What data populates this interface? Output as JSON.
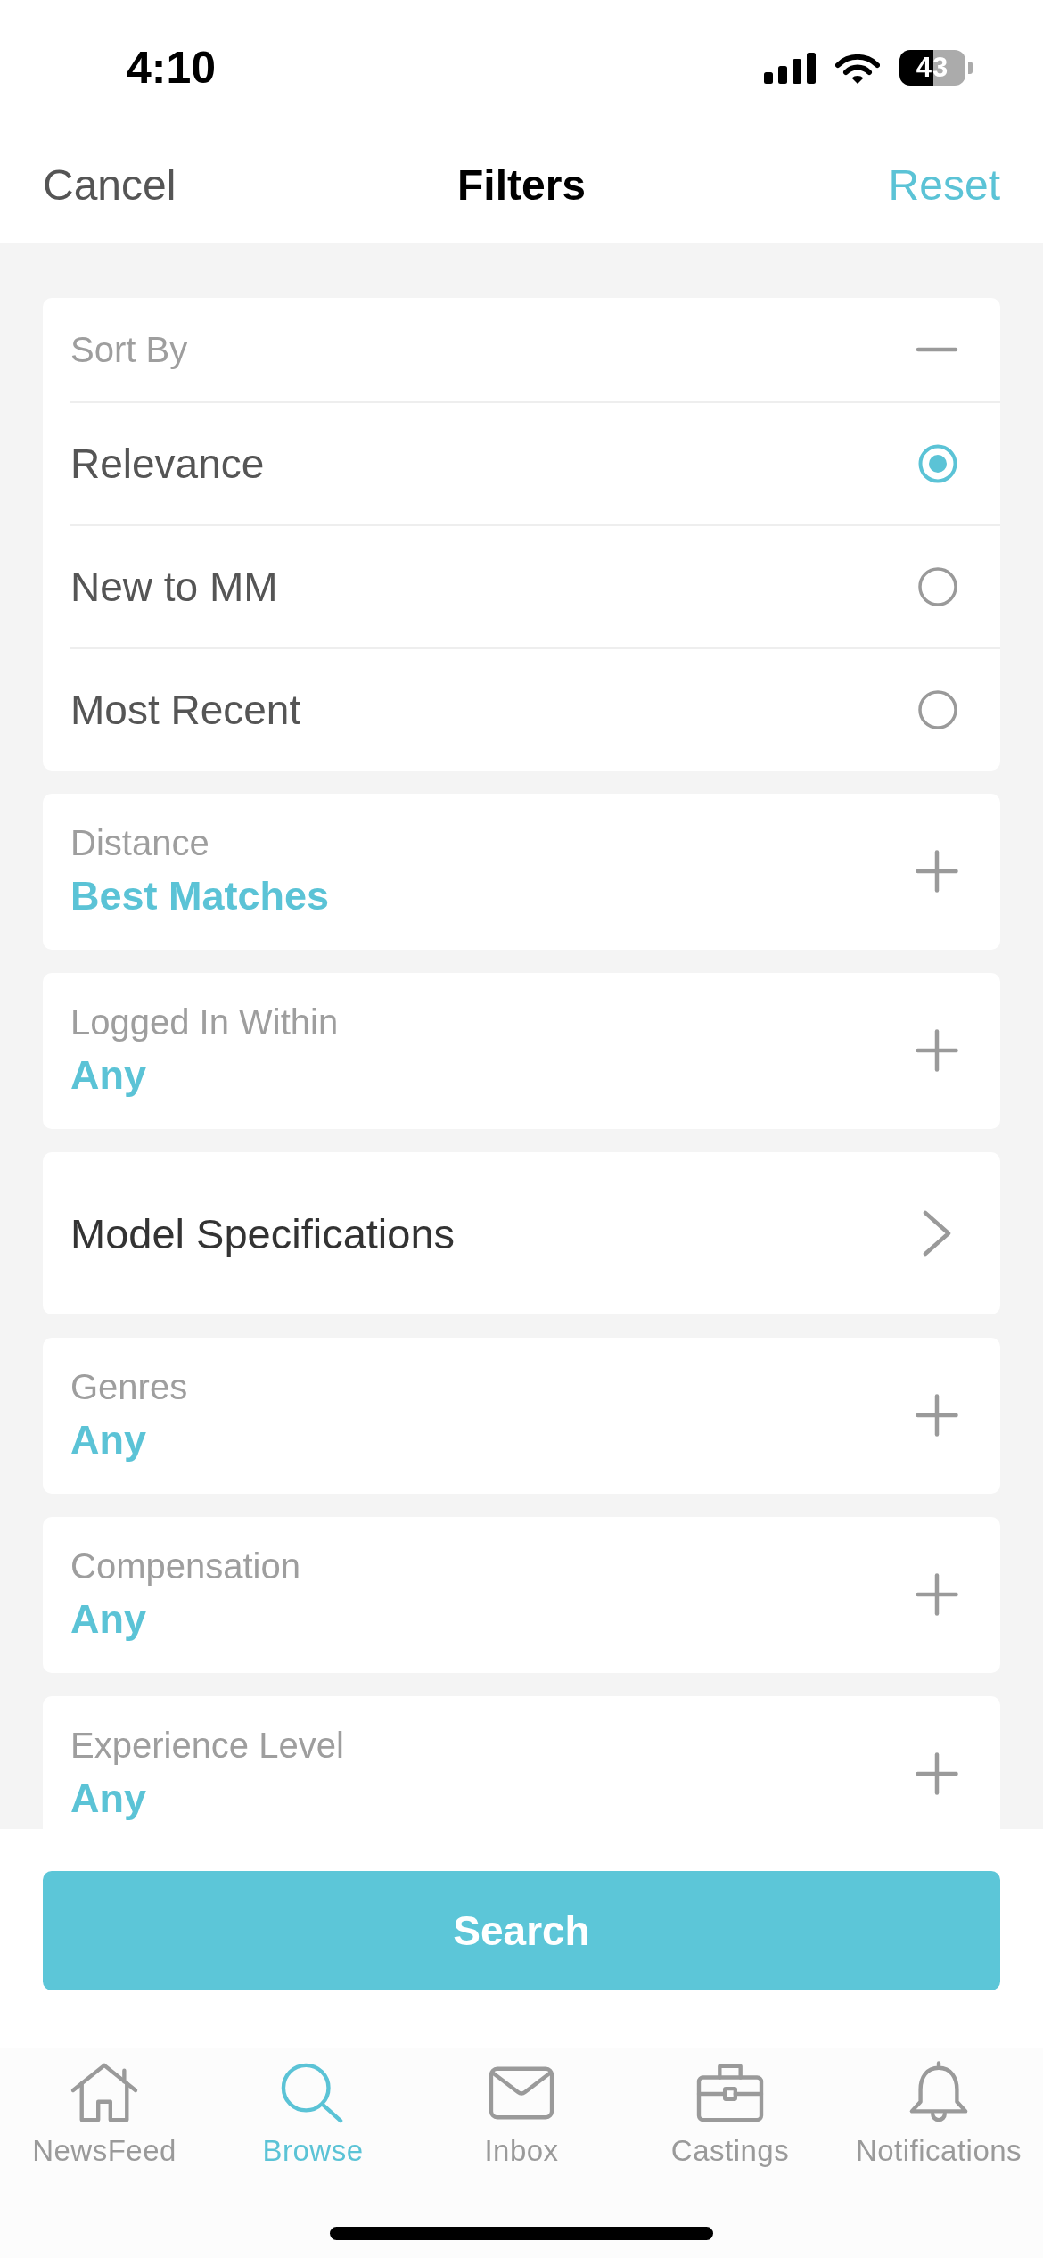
{
  "status_bar": {
    "time": "4:10",
    "battery": "43"
  },
  "nav_bar": {
    "cancel": "Cancel",
    "title": "Filters",
    "reset": "Reset"
  },
  "sort": {
    "title": "Sort By",
    "expanded": true,
    "options": [
      {
        "label": "Relevance",
        "selected": true
      },
      {
        "label": "New to MM",
        "selected": false
      },
      {
        "label": "Most Recent",
        "selected": false
      }
    ]
  },
  "filters": [
    {
      "kind": "select",
      "label": "Distance",
      "value": "Best Matches",
      "expanded": false
    },
    {
      "kind": "select",
      "label": "Logged In Within",
      "value": "Any",
      "expanded": false
    },
    {
      "kind": "link",
      "label": "Model Specifications"
    },
    {
      "kind": "select",
      "label": "Genres",
      "value": "Any",
      "expanded": false
    },
    {
      "kind": "select",
      "label": "Compensation",
      "value": "Any",
      "expanded": false
    },
    {
      "kind": "select",
      "label": "Experience Level",
      "value": "Any",
      "expanded": false
    }
  ],
  "search_button": "Search",
  "tab_bar": [
    {
      "label": "NewsFeed",
      "selected": false
    },
    {
      "label": "Browse",
      "selected": true
    },
    {
      "label": "Inbox",
      "selected": false
    },
    {
      "label": "Castings",
      "selected": false
    },
    {
      "label": "Notifications",
      "selected": false
    }
  ]
}
